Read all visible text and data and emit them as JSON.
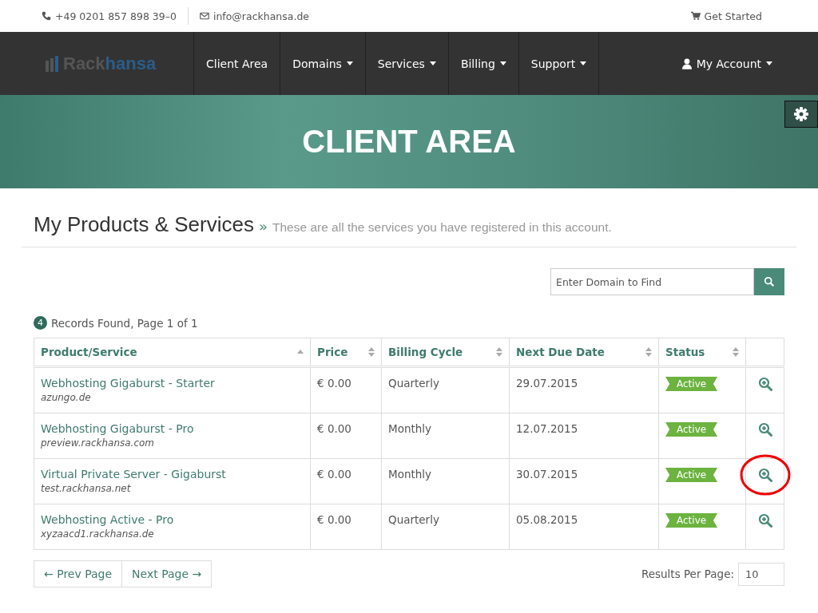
{
  "topbar": {
    "phone": "+49 0201 857 898 39–0",
    "email": "info@rackhansa.de",
    "cta": "Get Started"
  },
  "logo": {
    "part_1": "Rack",
    "part_2": "hansa"
  },
  "nav": [
    {
      "label": "Client Area",
      "dropdown": false
    },
    {
      "label": "Domains",
      "dropdown": true
    },
    {
      "label": "Services",
      "dropdown": true
    },
    {
      "label": "Billing",
      "dropdown": true
    },
    {
      "label": "Support",
      "dropdown": true
    }
  ],
  "account": {
    "label": "My Account",
    "dropdown": true
  },
  "hero": {
    "title": "CLIENT AREA"
  },
  "page": {
    "title": "My Products & Services",
    "separator": "»",
    "subtitle": "These are all the services you have registered in this account."
  },
  "search": {
    "placeholder": "Enter Domain to Find"
  },
  "records": {
    "count": "4",
    "text": "Records Found, Page 1 of 1"
  },
  "table": {
    "columns": [
      {
        "label": "Product/Service",
        "sorted": true
      },
      {
        "label": "Price",
        "sorted": false
      },
      {
        "label": "Billing Cycle",
        "sorted": false
      },
      {
        "label": "Next Due Date",
        "sorted": false
      },
      {
        "label": "Status",
        "sorted": false
      }
    ],
    "rows": [
      {
        "product": "Webhosting Gigaburst - Starter",
        "domain": "azungo.de",
        "price": "€ 0.00",
        "cycle": "Quarterly",
        "due": "29.07.2015",
        "status": "Active",
        "highlighted": false
      },
      {
        "product": "Webhosting Gigaburst - Pro",
        "domain": "preview.rackhansa.com",
        "price": "€ 0.00",
        "cycle": "Monthly",
        "due": "12.07.2015",
        "status": "Active",
        "highlighted": false
      },
      {
        "product": "Virtual Private Server - Gigaburst",
        "domain": "test.rackhansa.net",
        "price": "€ 0.00",
        "cycle": "Monthly",
        "due": "30.07.2015",
        "status": "Active",
        "highlighted": true
      },
      {
        "product": "Webhosting Active - Pro",
        "domain": "xyzaacd1.rackhansa.de",
        "price": "€ 0.00",
        "cycle": "Quarterly",
        "due": "05.08.2015",
        "status": "Active",
        "highlighted": false
      }
    ]
  },
  "pagination": {
    "prev": "← Prev Page",
    "next": "Next Page →"
  },
  "per_page": {
    "label": "Results Per Page:",
    "value": "10"
  }
}
